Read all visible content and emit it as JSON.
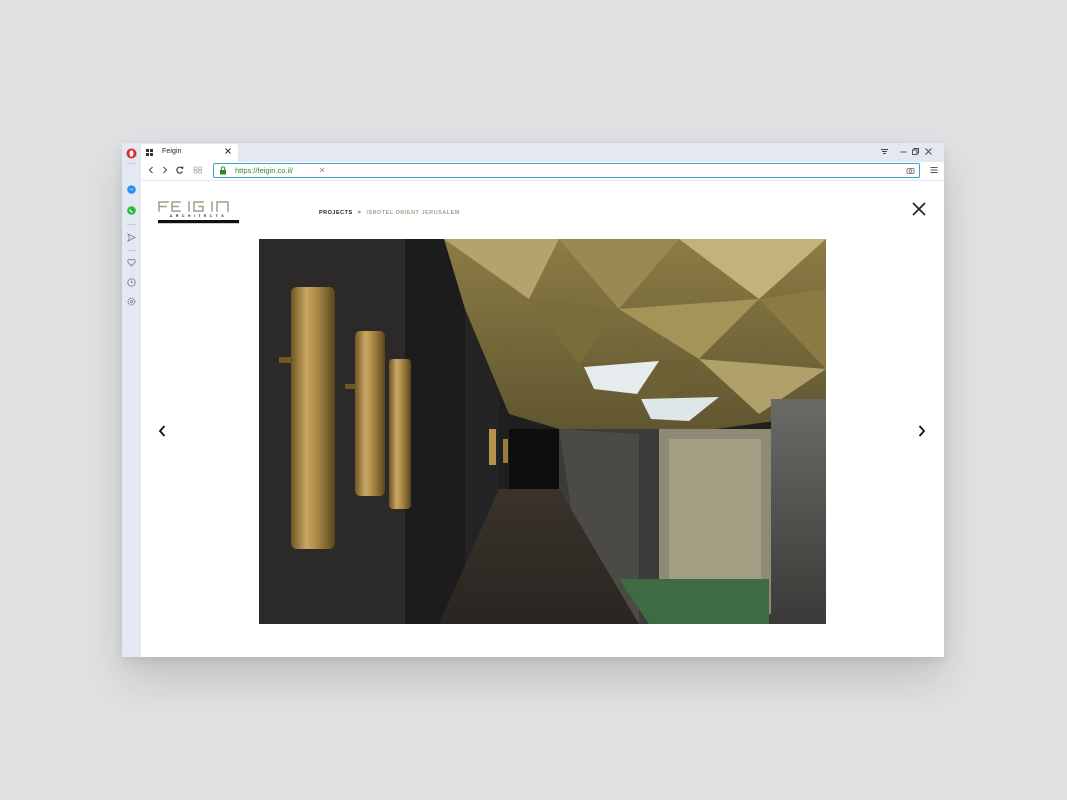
{
  "browser": {
    "tab_title": "Feigin",
    "url": "https://feigin.co.il/",
    "sidebar_icons": [
      "opera-logo-icon",
      "messenger-icon",
      "whatsapp-icon",
      "send-icon",
      "heart-icon",
      "history-clock-icon",
      "settings-gear-icon"
    ],
    "window_controls": [
      "tab-menu-icon",
      "minimize-icon",
      "restore-icon",
      "close-icon"
    ]
  },
  "site": {
    "logo_text": "FEIGIN",
    "logo_subtext": "ARCHITECTS",
    "breadcrumb": {
      "parent": "PROJECTS",
      "separator": ">",
      "current": "ISROTEL ORIENT JERUSALEM"
    },
    "gallery": {
      "image_alt": "Hotel corridor with brass wall sconces and faceted gold ceiling",
      "prev_icon": "chevron-left-icon",
      "next_icon": "chevron-right-icon",
      "close_icon": "close-x-icon"
    }
  },
  "colors": {
    "accent_url": "#2a8a2a",
    "urlbox_border": "#3fa3c8",
    "breadcrumb_current": "#a7a08c",
    "logo_gold": "#a39c86"
  }
}
